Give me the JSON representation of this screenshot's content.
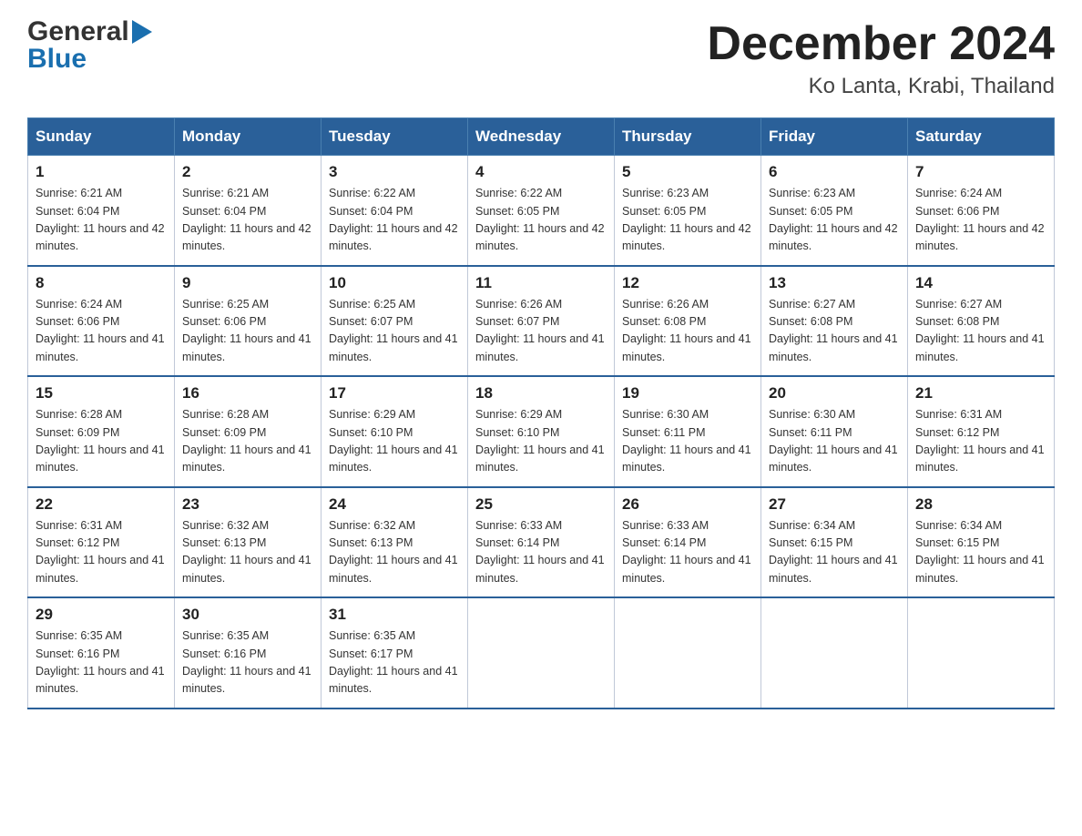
{
  "header": {
    "logo_general": "General",
    "logo_blue": "Blue",
    "month_title": "December 2024",
    "location": "Ko Lanta, Krabi, Thailand"
  },
  "days_of_week": [
    "Sunday",
    "Monday",
    "Tuesday",
    "Wednesday",
    "Thursday",
    "Friday",
    "Saturday"
  ],
  "weeks": [
    [
      {
        "day": "1",
        "sunrise": "Sunrise: 6:21 AM",
        "sunset": "Sunset: 6:04 PM",
        "daylight": "Daylight: 11 hours and 42 minutes."
      },
      {
        "day": "2",
        "sunrise": "Sunrise: 6:21 AM",
        "sunset": "Sunset: 6:04 PM",
        "daylight": "Daylight: 11 hours and 42 minutes."
      },
      {
        "day": "3",
        "sunrise": "Sunrise: 6:22 AM",
        "sunset": "Sunset: 6:04 PM",
        "daylight": "Daylight: 11 hours and 42 minutes."
      },
      {
        "day": "4",
        "sunrise": "Sunrise: 6:22 AM",
        "sunset": "Sunset: 6:05 PM",
        "daylight": "Daylight: 11 hours and 42 minutes."
      },
      {
        "day": "5",
        "sunrise": "Sunrise: 6:23 AM",
        "sunset": "Sunset: 6:05 PM",
        "daylight": "Daylight: 11 hours and 42 minutes."
      },
      {
        "day": "6",
        "sunrise": "Sunrise: 6:23 AM",
        "sunset": "Sunset: 6:05 PM",
        "daylight": "Daylight: 11 hours and 42 minutes."
      },
      {
        "day": "7",
        "sunrise": "Sunrise: 6:24 AM",
        "sunset": "Sunset: 6:06 PM",
        "daylight": "Daylight: 11 hours and 42 minutes."
      }
    ],
    [
      {
        "day": "8",
        "sunrise": "Sunrise: 6:24 AM",
        "sunset": "Sunset: 6:06 PM",
        "daylight": "Daylight: 11 hours and 41 minutes."
      },
      {
        "day": "9",
        "sunrise": "Sunrise: 6:25 AM",
        "sunset": "Sunset: 6:06 PM",
        "daylight": "Daylight: 11 hours and 41 minutes."
      },
      {
        "day": "10",
        "sunrise": "Sunrise: 6:25 AM",
        "sunset": "Sunset: 6:07 PM",
        "daylight": "Daylight: 11 hours and 41 minutes."
      },
      {
        "day": "11",
        "sunrise": "Sunrise: 6:26 AM",
        "sunset": "Sunset: 6:07 PM",
        "daylight": "Daylight: 11 hours and 41 minutes."
      },
      {
        "day": "12",
        "sunrise": "Sunrise: 6:26 AM",
        "sunset": "Sunset: 6:08 PM",
        "daylight": "Daylight: 11 hours and 41 minutes."
      },
      {
        "day": "13",
        "sunrise": "Sunrise: 6:27 AM",
        "sunset": "Sunset: 6:08 PM",
        "daylight": "Daylight: 11 hours and 41 minutes."
      },
      {
        "day": "14",
        "sunrise": "Sunrise: 6:27 AM",
        "sunset": "Sunset: 6:08 PM",
        "daylight": "Daylight: 11 hours and 41 minutes."
      }
    ],
    [
      {
        "day": "15",
        "sunrise": "Sunrise: 6:28 AM",
        "sunset": "Sunset: 6:09 PM",
        "daylight": "Daylight: 11 hours and 41 minutes."
      },
      {
        "day": "16",
        "sunrise": "Sunrise: 6:28 AM",
        "sunset": "Sunset: 6:09 PM",
        "daylight": "Daylight: 11 hours and 41 minutes."
      },
      {
        "day": "17",
        "sunrise": "Sunrise: 6:29 AM",
        "sunset": "Sunset: 6:10 PM",
        "daylight": "Daylight: 11 hours and 41 minutes."
      },
      {
        "day": "18",
        "sunrise": "Sunrise: 6:29 AM",
        "sunset": "Sunset: 6:10 PM",
        "daylight": "Daylight: 11 hours and 41 minutes."
      },
      {
        "day": "19",
        "sunrise": "Sunrise: 6:30 AM",
        "sunset": "Sunset: 6:11 PM",
        "daylight": "Daylight: 11 hours and 41 minutes."
      },
      {
        "day": "20",
        "sunrise": "Sunrise: 6:30 AM",
        "sunset": "Sunset: 6:11 PM",
        "daylight": "Daylight: 11 hours and 41 minutes."
      },
      {
        "day": "21",
        "sunrise": "Sunrise: 6:31 AM",
        "sunset": "Sunset: 6:12 PM",
        "daylight": "Daylight: 11 hours and 41 minutes."
      }
    ],
    [
      {
        "day": "22",
        "sunrise": "Sunrise: 6:31 AM",
        "sunset": "Sunset: 6:12 PM",
        "daylight": "Daylight: 11 hours and 41 minutes."
      },
      {
        "day": "23",
        "sunrise": "Sunrise: 6:32 AM",
        "sunset": "Sunset: 6:13 PM",
        "daylight": "Daylight: 11 hours and 41 minutes."
      },
      {
        "day": "24",
        "sunrise": "Sunrise: 6:32 AM",
        "sunset": "Sunset: 6:13 PM",
        "daylight": "Daylight: 11 hours and 41 minutes."
      },
      {
        "day": "25",
        "sunrise": "Sunrise: 6:33 AM",
        "sunset": "Sunset: 6:14 PM",
        "daylight": "Daylight: 11 hours and 41 minutes."
      },
      {
        "day": "26",
        "sunrise": "Sunrise: 6:33 AM",
        "sunset": "Sunset: 6:14 PM",
        "daylight": "Daylight: 11 hours and 41 minutes."
      },
      {
        "day": "27",
        "sunrise": "Sunrise: 6:34 AM",
        "sunset": "Sunset: 6:15 PM",
        "daylight": "Daylight: 11 hours and 41 minutes."
      },
      {
        "day": "28",
        "sunrise": "Sunrise: 6:34 AM",
        "sunset": "Sunset: 6:15 PM",
        "daylight": "Daylight: 11 hours and 41 minutes."
      }
    ],
    [
      {
        "day": "29",
        "sunrise": "Sunrise: 6:35 AM",
        "sunset": "Sunset: 6:16 PM",
        "daylight": "Daylight: 11 hours and 41 minutes."
      },
      {
        "day": "30",
        "sunrise": "Sunrise: 6:35 AM",
        "sunset": "Sunset: 6:16 PM",
        "daylight": "Daylight: 11 hours and 41 minutes."
      },
      {
        "day": "31",
        "sunrise": "Sunrise: 6:35 AM",
        "sunset": "Sunset: 6:17 PM",
        "daylight": "Daylight: 11 hours and 41 minutes."
      },
      null,
      null,
      null,
      null
    ]
  ]
}
